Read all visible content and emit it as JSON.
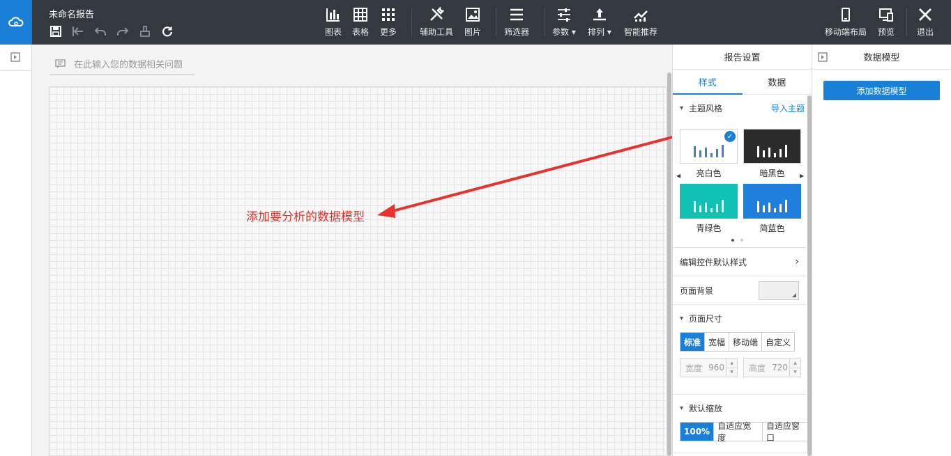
{
  "header": {
    "doc_title": "未命名报告",
    "tools": [
      {
        "label": "图表",
        "icon": "bar-chart-icon"
      },
      {
        "label": "表格",
        "icon": "table-icon"
      },
      {
        "label": "更多",
        "icon": "grid-more-icon"
      },
      {
        "label": "辅助工具",
        "icon": "tools-icon"
      },
      {
        "label": "图片",
        "icon": "image-icon"
      },
      {
        "label": "筛选器",
        "icon": "filter-icon"
      },
      {
        "label": "参数",
        "icon": "params-icon"
      },
      {
        "label": "排列",
        "icon": "arrange-icon"
      },
      {
        "label": "智能推荐",
        "icon": "smart-recommend-icon"
      },
      {
        "label": "移动端布局",
        "icon": "mobile-icon"
      },
      {
        "label": "预览",
        "icon": "preview-icon"
      },
      {
        "label": "退出",
        "icon": "close-icon"
      }
    ]
  },
  "canvas": {
    "question_placeholder": "在此输入您的数据相关问题",
    "annotation": "添加要分析的数据模型"
  },
  "settings": {
    "title": "报告设置",
    "tabs": [
      "样式",
      "数据"
    ],
    "active_tab": "样式",
    "theme_section": "主题风格",
    "import_theme": "导入主题",
    "themes": [
      {
        "name": "亮白色",
        "bg": "#ffffff",
        "bar": "#3b82d6",
        "selected": true
      },
      {
        "name": "暗黑色",
        "bg": "#2b2b2b",
        "bar": "#ffffff",
        "selected": false
      },
      {
        "name": "青绿色",
        "bg": "#12c1b6",
        "bar": "#ffffff",
        "selected": false
      },
      {
        "name": "简蓝色",
        "bg": "#1e7fdc",
        "bar": "#ffffff",
        "selected": false
      }
    ],
    "edit_default_style": "编辑控件默认样式",
    "page_bg": "页面背景",
    "page_size": "页面尺寸",
    "size_options": [
      "标准",
      "宽幅",
      "移动端",
      "自定义"
    ],
    "width_label": "宽度",
    "width_value": "960",
    "height_label": "高度",
    "height_value": "720",
    "default_zoom": "默认缩放",
    "zoom_options": [
      "100%",
      "自适应宽度",
      "自适应窗口"
    ]
  },
  "model": {
    "title": "数据模型",
    "add_button": "添加数据模型"
  },
  "colors": {
    "accent": "#1a7fd6",
    "toolbar": "#33393f",
    "annotation": "#e8322c"
  }
}
